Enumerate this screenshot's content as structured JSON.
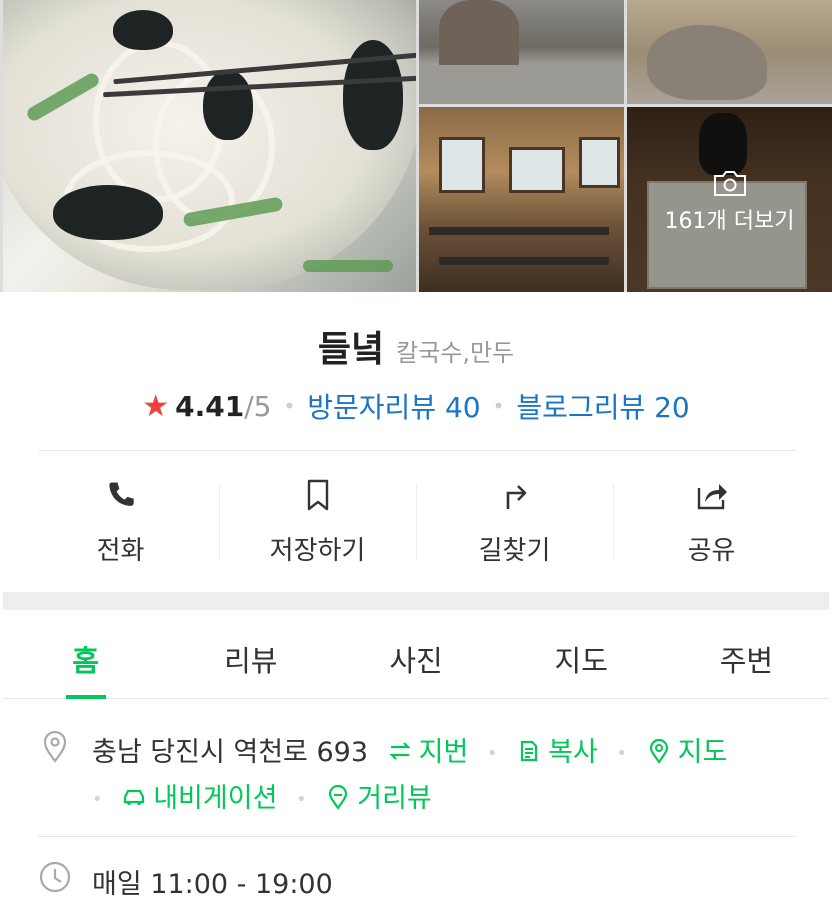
{
  "gallery": {
    "more_label": "161개 더보기"
  },
  "place": {
    "name": "들녘",
    "category": "칼국수,만두",
    "rating": "4.41",
    "rating_max": "/5",
    "visitor_reviews": "방문자리뷰 40",
    "blog_reviews": "블로그리뷰 20"
  },
  "actions": [
    {
      "label": "전화",
      "icon": "phone-icon"
    },
    {
      "label": "저장하기",
      "icon": "bookmark-icon"
    },
    {
      "label": "길찾기",
      "icon": "directions-icon"
    },
    {
      "label": "공유",
      "icon": "share-icon"
    }
  ],
  "tabs": [
    {
      "label": "홈",
      "active": true
    },
    {
      "label": "리뷰"
    },
    {
      "label": "사진"
    },
    {
      "label": "지도"
    },
    {
      "label": "주변"
    }
  ],
  "address": {
    "text": "충남 당진시 역천로 693",
    "lot_number": "지번",
    "copy": "복사",
    "map": "지도",
    "navigation": "내비게이션",
    "street_view": "거리뷰"
  },
  "hours": {
    "text": "매일 11:00 - 19:00"
  },
  "colors": {
    "accent_green": "#03c75a",
    "link_blue": "#1c74c4",
    "star_red": "#f0413d"
  }
}
